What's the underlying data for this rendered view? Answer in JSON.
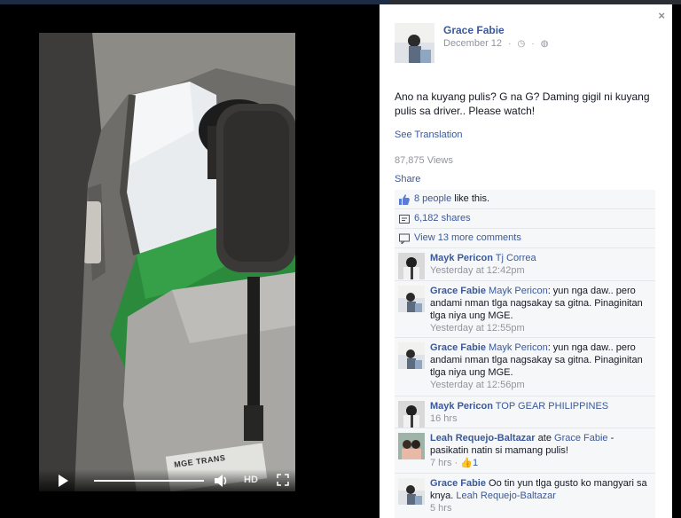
{
  "video": {
    "label_text": "MGE TRANS",
    "controls": {
      "quality": "HD"
    }
  },
  "post": {
    "author": "Grace Fabie",
    "date": "December 12",
    "text": "Ano na kuyang pulis? G na G? Daming gigil ni kuyang pulis sa driver.. Please watch!",
    "see_translation": "See Translation",
    "views": "87,875 Views",
    "share": "Share",
    "close": "×"
  },
  "ufi": {
    "likes_link": "8 people",
    "likes_rest": " like this.",
    "shares": "6,182 shares",
    "more_comments": "View 13 more comments"
  },
  "comments": [
    {
      "author": "Mayk Pericon",
      "tag": "Tj Correa",
      "text": "",
      "time": "Yesterday at 12:42pm",
      "likes": ""
    },
    {
      "author": "Grace Fabie",
      "tag": "Mayk Pericon",
      "text": ": yun nga daw.. pero andami nman tlga nagsakay sa gitna. Pinaginitan tlga niya ung MGE.",
      "time": "Yesterday at 12:55pm",
      "likes": ""
    },
    {
      "author": "Grace Fabie",
      "tag": "Mayk Pericon",
      "text": ": yun nga daw.. pero andami nman tlga nagsakay sa gitna. Pinaginitan tlga niya ung MGE.",
      "time": "Yesterday at 12:56pm",
      "likes": ""
    },
    {
      "author": "Mayk Pericon",
      "tag": "TOP GEAR PHILIPPINES",
      "text": "",
      "time": "16 hrs",
      "likes": ""
    },
    {
      "author": "Leah Requejo-Baltazar",
      "tag": "",
      "text": "ate ",
      "tag2": "Grace Fabie",
      "text2": " - pasikatin natin si mamang pulis!",
      "time": "7 hrs",
      "likes": "1"
    },
    {
      "author": "Grace Fabie",
      "tag": "",
      "text": "Oo tin yun tlga gusto ko mangyari sa knya. ",
      "tag2": "Leah Requejo-Baltazar",
      "text2": "",
      "time": "5 hrs",
      "likes": ""
    }
  ],
  "colors": {
    "link": "#3b5998",
    "muted": "#90949c",
    "ufi_bg": "#f6f7f9",
    "green_shirt": "#2c8a3c"
  }
}
